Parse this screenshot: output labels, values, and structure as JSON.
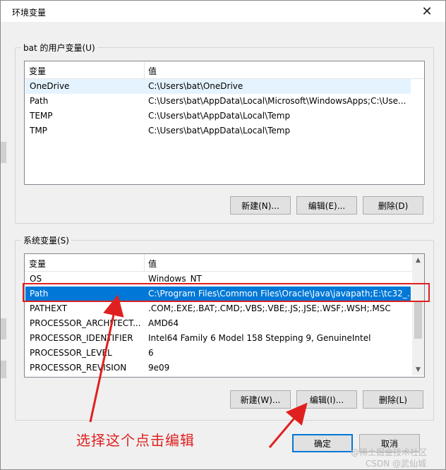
{
  "window": {
    "title": "环境变量",
    "close_glyph": "✕"
  },
  "user_vars": {
    "group_label": "bat 的用户变量(U)",
    "headers": {
      "name": "变量",
      "value": "值"
    },
    "rows": [
      {
        "name": "OneDrive",
        "value": "C:\\Users\\bat\\OneDrive"
      },
      {
        "name": "Path",
        "value": "C:\\Users\\bat\\AppData\\Local\\Microsoft\\WindowsApps;C:\\Use..."
      },
      {
        "name": "TEMP",
        "value": "C:\\Users\\bat\\AppData\\Local\\Temp"
      },
      {
        "name": "TMP",
        "value": "C:\\Users\\bat\\AppData\\Local\\Temp"
      }
    ],
    "buttons": {
      "new": "新建(N)...",
      "edit": "编辑(E)...",
      "delete": "删除(D)"
    }
  },
  "system_vars": {
    "group_label": "系统变量(S)",
    "headers": {
      "name": "变量",
      "value": "值"
    },
    "rows": [
      {
        "name": "OS",
        "value": "Windows_NT"
      },
      {
        "name": "Path",
        "value": "C:\\Program Files\\Common Files\\Oracle\\Java\\javapath;E:\\tc32_..."
      },
      {
        "name": "PATHEXT",
        "value": ".COM;.EXE;.BAT;.CMD;.VBS;.VBE;.JS;.JSE;.WSF;.WSH;.MSC"
      },
      {
        "name": "PROCESSOR_ARCHITECT...",
        "value": "AMD64"
      },
      {
        "name": "PROCESSOR_IDENTIFIER",
        "value": "Intel64 Family 6 Model 158 Stepping 9, GenuineIntel"
      },
      {
        "name": "PROCESSOR_LEVEL",
        "value": "6"
      },
      {
        "name": "PROCESSOR_REVISION",
        "value": "9e09"
      }
    ],
    "buttons": {
      "new": "新建(W)...",
      "edit": "编辑(I)...",
      "delete": "删除(L)"
    }
  },
  "footer": {
    "ok": "确定",
    "cancel": "取消"
  },
  "annotation": {
    "text": "选择这个点击编辑",
    "color": "#e02020"
  },
  "watermark": {
    "line1": "@稀土掘金技术社区",
    "line2": "CSDN @武仙城"
  },
  "colors": {
    "selection": "#0078d7",
    "primary_border": "#0078d7"
  }
}
